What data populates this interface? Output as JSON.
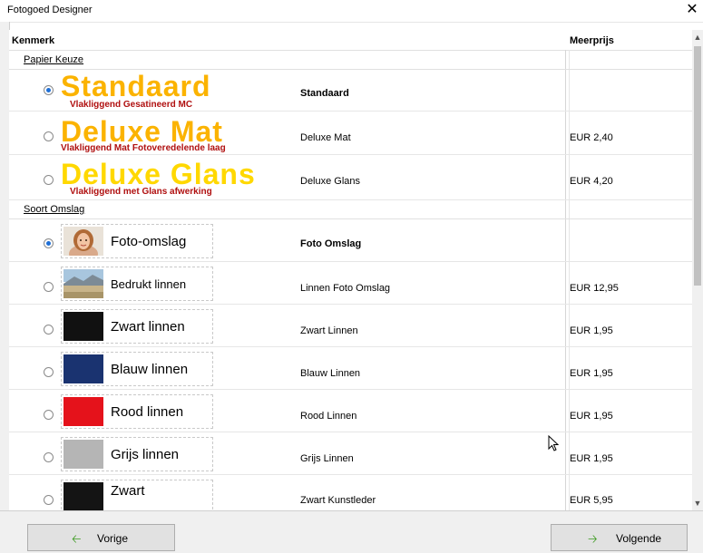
{
  "window": {
    "title": "Fotogoed Designer",
    "close": "✕"
  },
  "table": {
    "col_kenmerk": "Kenmerk",
    "col_meerprijs": "Meerprijs",
    "sections": [
      {
        "label": "Papier Keuze",
        "rows": [
          {
            "big": "Standaard",
            "sub": "Vlakliggend Gesatineerd MC",
            "desc": "Standaard",
            "price": "",
            "checked": true
          },
          {
            "big": "Deluxe Mat",
            "sub": "Vlakliggend Mat Fotoveredelende laag",
            "desc": "Deluxe Mat",
            "price": "EUR 2,40",
            "checked": false
          },
          {
            "big": "Deluxe Glans",
            "sub": "Vlakliggend met Glans afwerking",
            "desc": "Deluxe Glans",
            "price": "EUR 4,20",
            "checked": false
          }
        ]
      },
      {
        "label": "Soort Omslag",
        "rows": [
          {
            "card": "Foto-omslag",
            "swatch": "photo-portrait",
            "desc": "Foto Omslag",
            "price": "",
            "checked": true
          },
          {
            "card": "Bedrukt linnen",
            "swatch": "photo-landscape",
            "desc": "Linnen Foto Omslag",
            "price": "EUR 12,95",
            "checked": false
          },
          {
            "card": "Zwart linnen",
            "swatch": "#111111",
            "desc": "Zwart Linnen",
            "price": "EUR 1,95",
            "checked": false
          },
          {
            "card": "Blauw linnen",
            "swatch": "#1a3370",
            "desc": "Blauw Linnen",
            "price": "EUR 1,95",
            "checked": false
          },
          {
            "card": "Rood linnen",
            "swatch": "#e5121b",
            "desc": "Rood Linnen",
            "price": "EUR 1,95",
            "checked": false
          },
          {
            "card": "Grijs linnen",
            "swatch": "#b5b5b5",
            "desc": "Grijs Linnen",
            "price": "EUR 1,95",
            "checked": false
          },
          {
            "card": "Zwart",
            "swatch": "#141414",
            "desc": "Zwart Kunstleder",
            "price": "EUR 5,95",
            "checked": false
          }
        ]
      }
    ]
  },
  "footer": {
    "prev_label": "Vorige",
    "prev_icon": "arrow-left-icon",
    "next_label": "Volgende",
    "next_icon": "arrow-right-icon",
    "arrow_color": "#3a9a1e"
  }
}
